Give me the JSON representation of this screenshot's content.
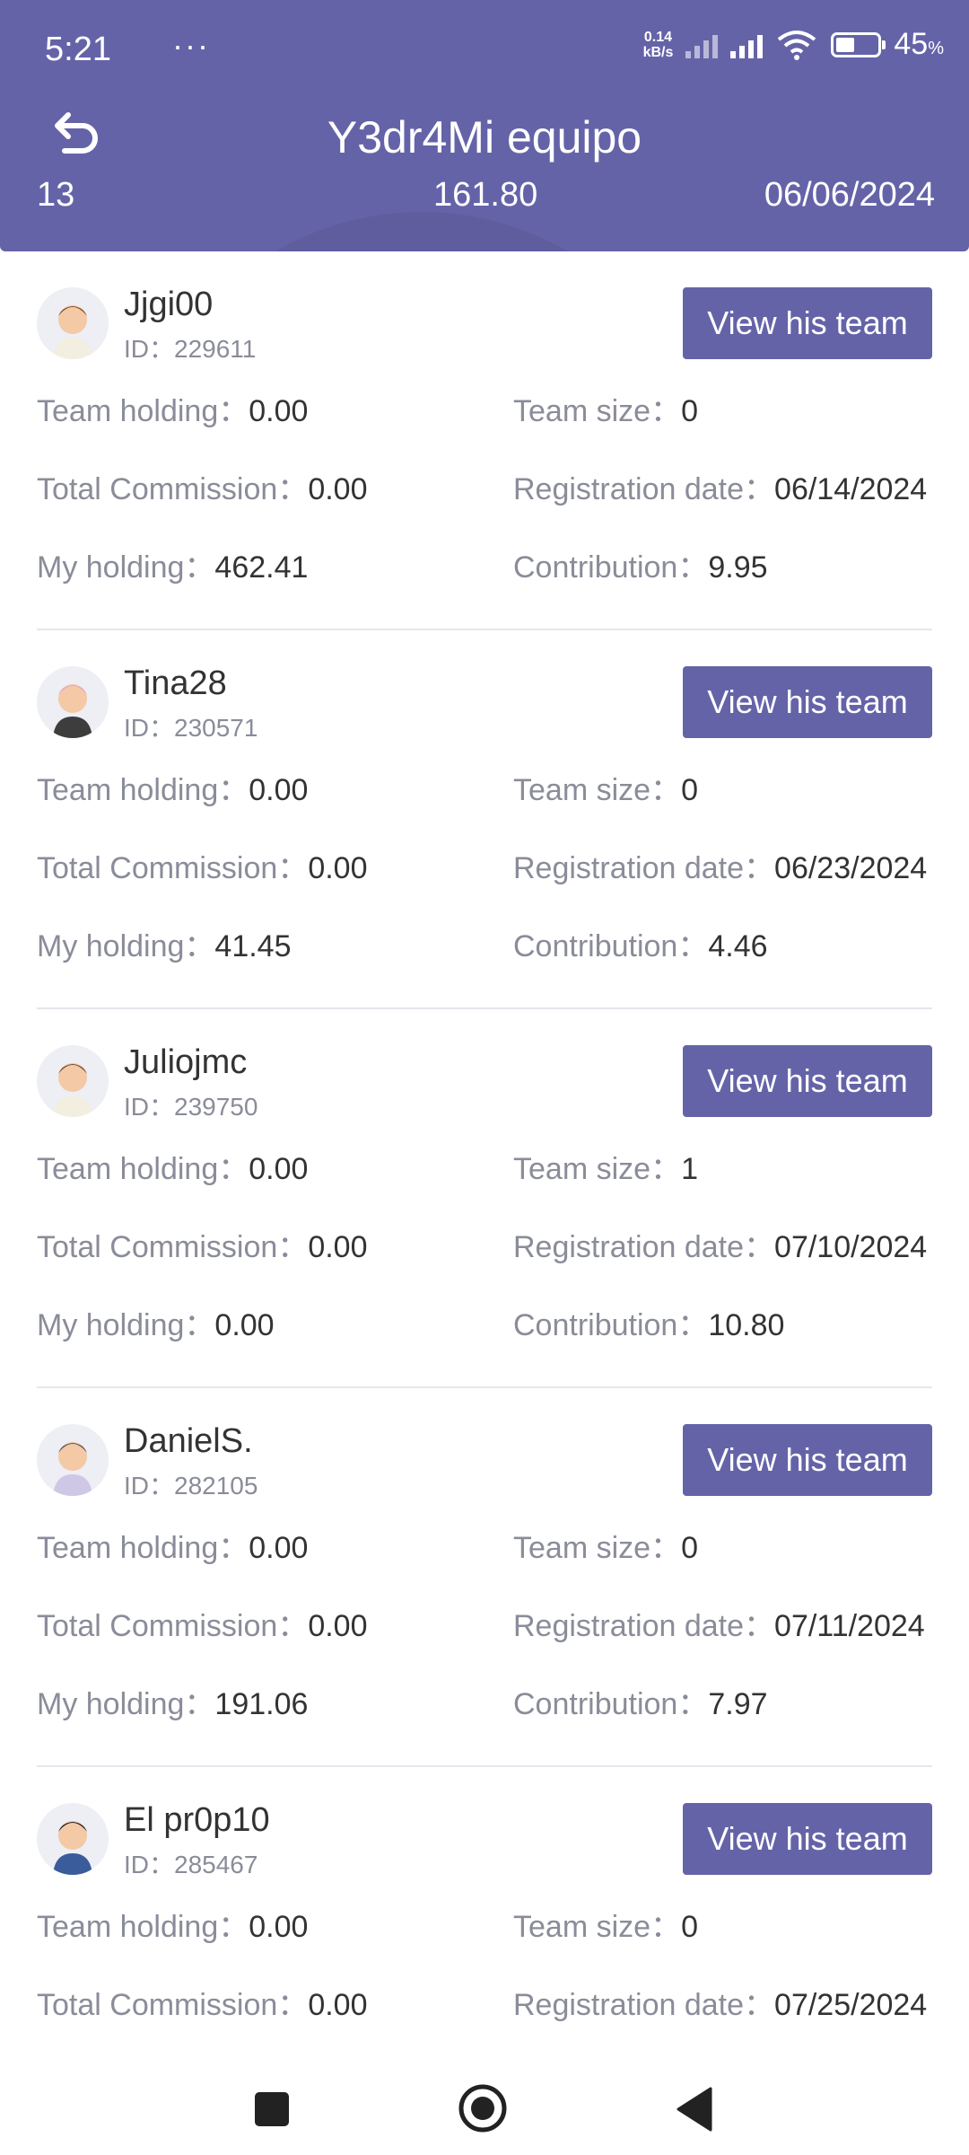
{
  "status_bar": {
    "time": "5:21",
    "dots": "···",
    "speed_value": "0.14",
    "speed_unit": "kB/s",
    "battery_value": "45",
    "battery_percent": "%",
    "battery_level": 0.45
  },
  "header": {
    "title": "Y3dr4Mi equipo",
    "summary": [
      "13",
      "161.80",
      "06/06/2024"
    ]
  },
  "labels": {
    "team_holding": "Team holding：",
    "total_commission": "Total Commission：",
    "my_holding": "My holding：",
    "team_size": "Team size：",
    "registration_date": "Registration date：",
    "contribution": "Contribution：",
    "id_prefix": "ID：",
    "view_button": "View his team"
  },
  "members": [
    {
      "name": "Jjgi00",
      "id": "229611",
      "team_holding": "0.00",
      "total_commission": "0.00",
      "my_holding": "462.41",
      "team_size": "0",
      "registration_date": "06/14/2024",
      "contribution": "9.95",
      "avatar": "man-avatar-icon"
    },
    {
      "name": "Tina28",
      "id": "230571",
      "team_holding": "0.00",
      "total_commission": "0.00",
      "my_holding": "41.45",
      "team_size": "0",
      "registration_date": "06/23/2024",
      "contribution": "4.46",
      "avatar": "woman-avatar-icon"
    },
    {
      "name": "Juliojmc",
      "id": "239750",
      "team_holding": "0.00",
      "total_commission": "0.00",
      "my_holding": "0.00",
      "team_size": "1",
      "registration_date": "07/10/2024",
      "contribution": "10.80",
      "avatar": "man-avatar-icon"
    },
    {
      "name": "DanielS.",
      "id": "282105",
      "team_holding": "0.00",
      "total_commission": "0.00",
      "my_holding": "191.06",
      "team_size": "0",
      "registration_date": "07/11/2024",
      "contribution": "7.97",
      "avatar": "cap-avatar-icon"
    },
    {
      "name": "El pr0p10",
      "id": "285467",
      "team_holding": "0.00",
      "total_commission": "0.00",
      "my_holding": "",
      "team_size": "0",
      "registration_date": "07/25/2024",
      "contribution": "",
      "avatar": "boy-avatar-icon"
    }
  ],
  "colors": {
    "accent": "#6563a8",
    "label": "#8a8c99",
    "value": "#333333"
  }
}
